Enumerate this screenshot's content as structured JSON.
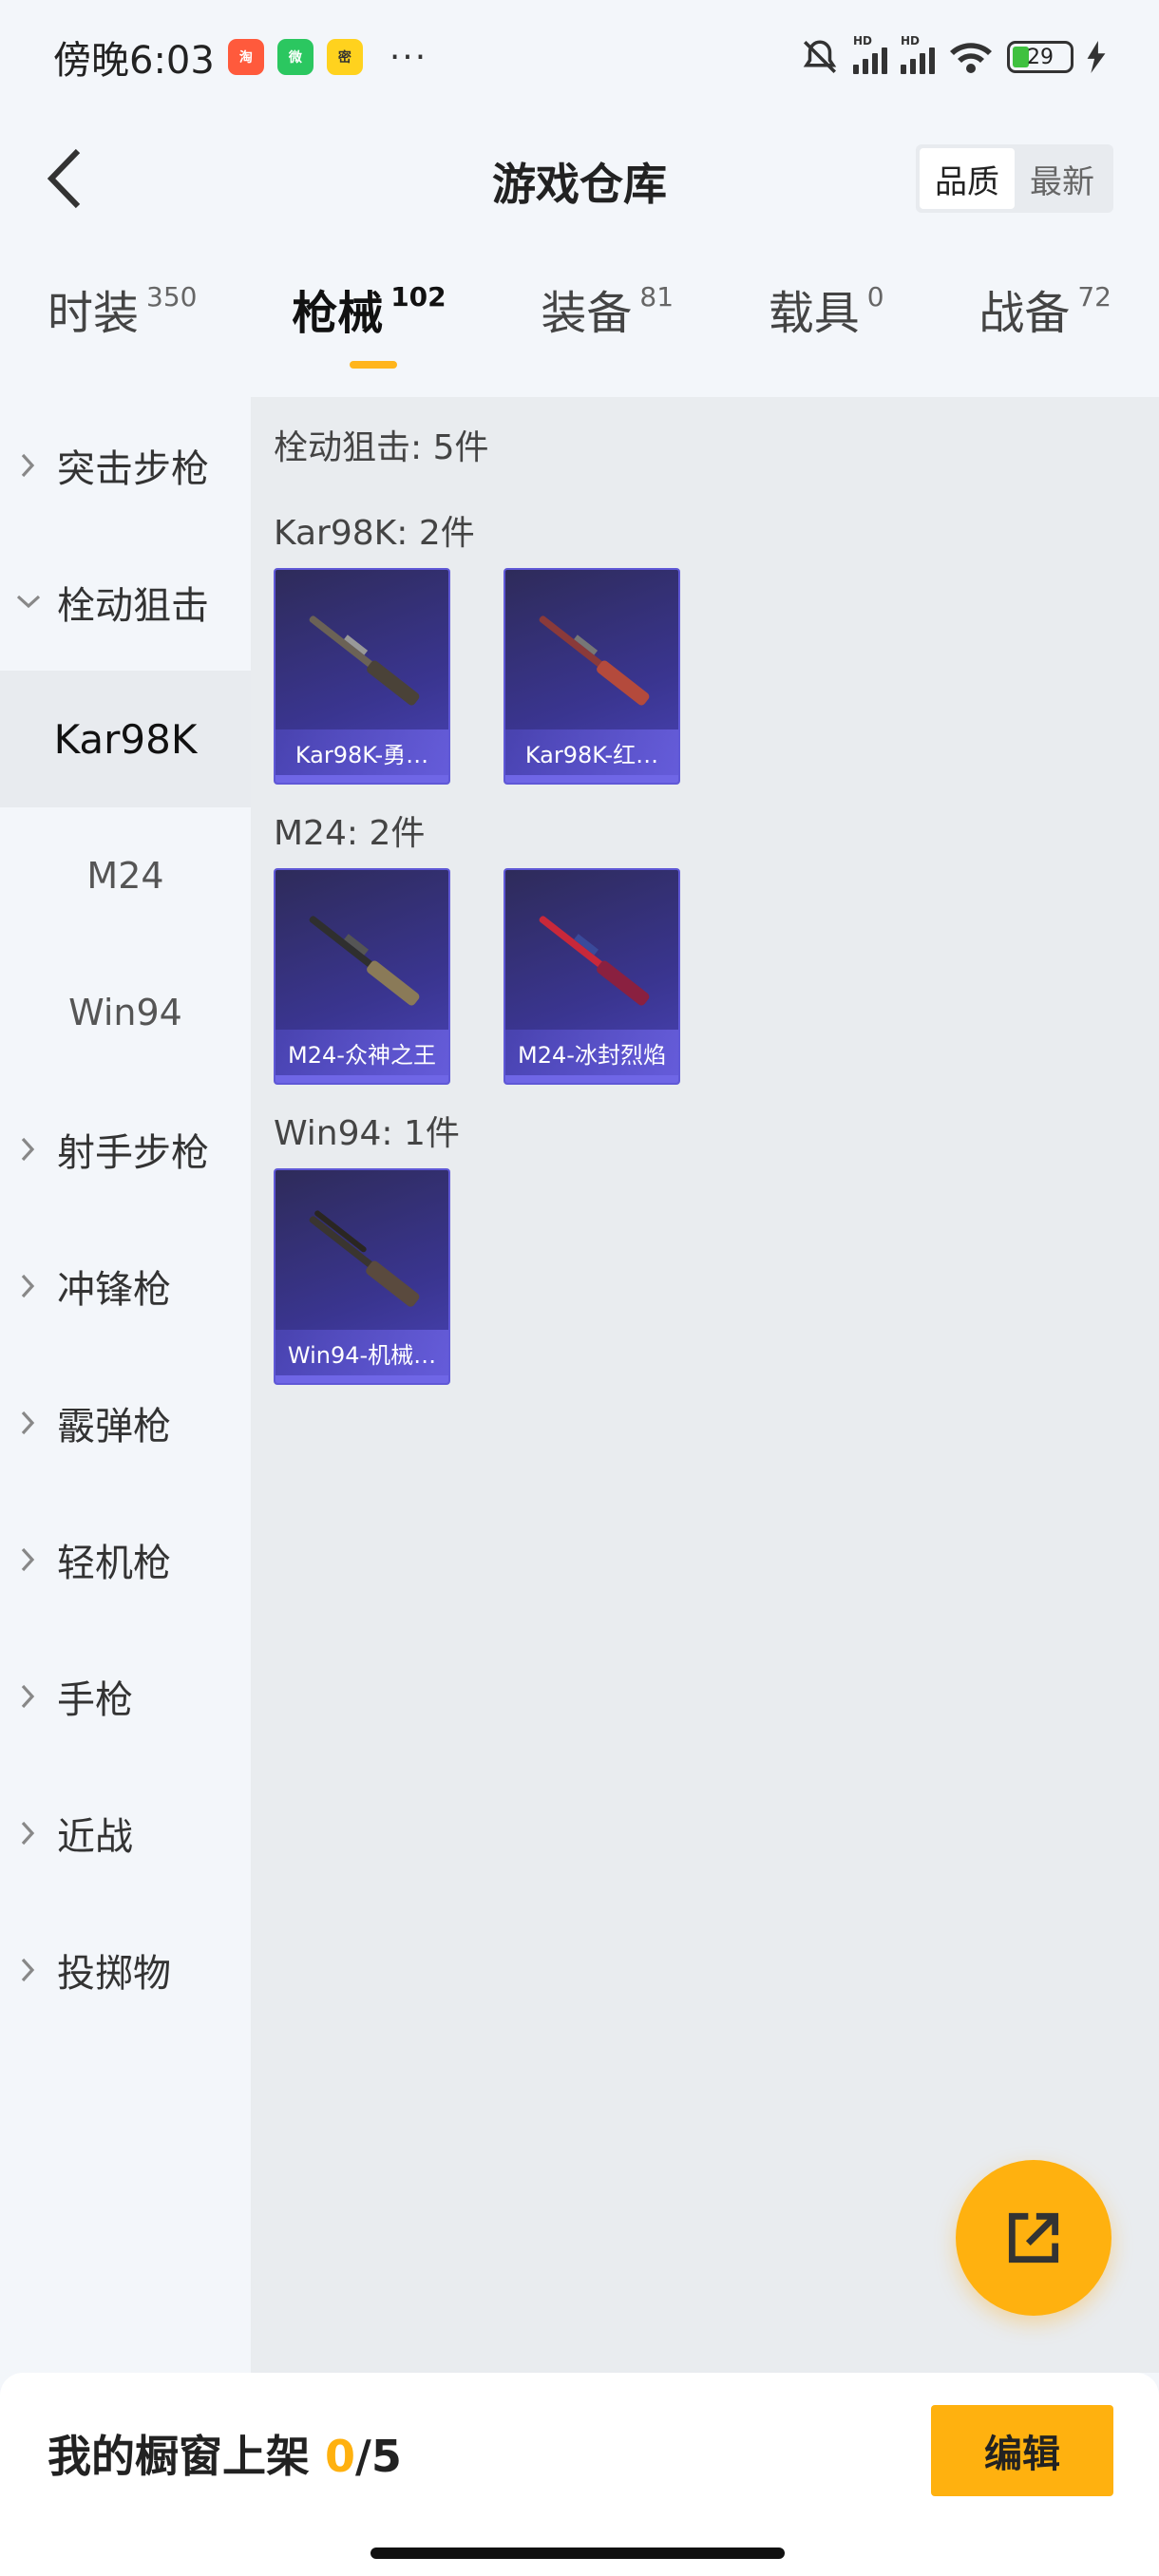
{
  "status_bar": {
    "time": "傍晚6:03",
    "apps": [
      {
        "name": "taobao-app-icon",
        "glyph": "淘"
      },
      {
        "name": "wechat-app-icon",
        "glyph": "微"
      },
      {
        "name": "game-app-icon",
        "glyph": "密"
      }
    ],
    "more": "···",
    "signal_label": "HD",
    "battery": "29"
  },
  "header": {
    "title": "游戏仓库",
    "sort_options": [
      "品质",
      "最新"
    ],
    "active_sort": 0
  },
  "tabs": [
    {
      "label": "时装",
      "count": "350"
    },
    {
      "label": "枪械",
      "count": "102"
    },
    {
      "label": "装备",
      "count": "81"
    },
    {
      "label": "载具",
      "count": "0"
    },
    {
      "label": "战备",
      "count": "72"
    }
  ],
  "active_tab": 1,
  "sidebar": {
    "items": [
      {
        "label": "突击步枪",
        "type": "category",
        "expanded": false
      },
      {
        "label": "栓动狙击",
        "type": "category",
        "expanded": true
      },
      {
        "label": "Kar98K",
        "type": "sub",
        "selected": true
      },
      {
        "label": "M24",
        "type": "sub",
        "selected": false
      },
      {
        "label": "Win94",
        "type": "sub",
        "selected": false
      },
      {
        "label": "射手步枪",
        "type": "category",
        "expanded": false
      },
      {
        "label": "冲锋枪",
        "type": "category",
        "expanded": false
      },
      {
        "label": "霰弹枪",
        "type": "category",
        "expanded": false
      },
      {
        "label": "轻机枪",
        "type": "category",
        "expanded": false
      },
      {
        "label": "手枪",
        "type": "category",
        "expanded": false
      },
      {
        "label": "近战",
        "type": "category",
        "expanded": false
      },
      {
        "label": "投掷物",
        "type": "category",
        "expanded": false
      }
    ]
  },
  "main": {
    "section_title": "栓动狙击: 5件",
    "groups": [
      {
        "title": "Kar98K: 2件",
        "items": [
          {
            "label": "Kar98K-勇…",
            "color": "#6b6256"
          },
          {
            "label": "Kar98K-红…",
            "color": "#8a3a3a"
          }
        ]
      },
      {
        "title": "M24: 2件",
        "items": [
          {
            "label": "M24-众神之王",
            "color": "#8a7a58"
          },
          {
            "label": "M24-冰封烈焰",
            "color": "#c8283a"
          }
        ]
      },
      {
        "title": "Win94: 1件",
        "items": [
          {
            "label": "Win94-机械…",
            "color": "#5a4a3e"
          }
        ]
      }
    ]
  },
  "bottom_bar": {
    "prefix": "我的橱窗上架 ",
    "current": "0",
    "total": "/5",
    "edit_label": "编辑"
  },
  "colors": {
    "accent": "#ffb10f",
    "card_bg": "#3a3590",
    "card_border": "#5f58d6"
  }
}
